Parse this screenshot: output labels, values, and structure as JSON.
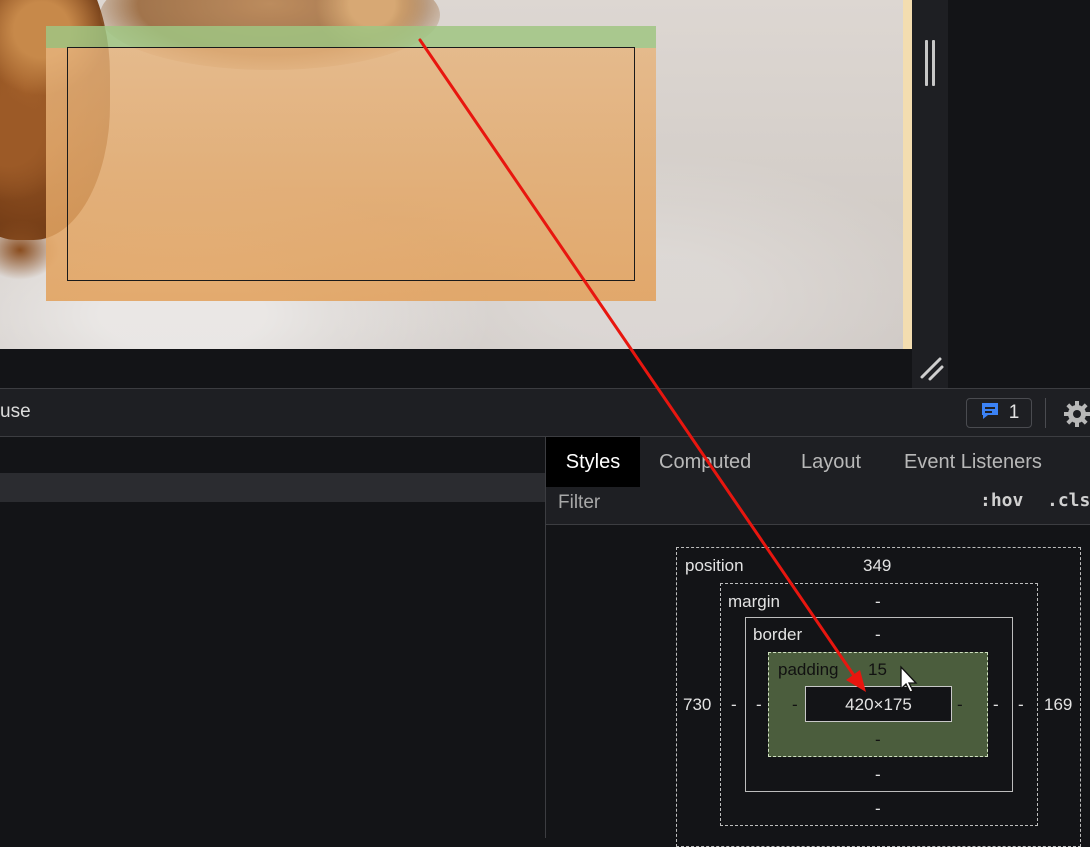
{
  "toolbar": {
    "partial_text": "use",
    "issues_count": "1"
  },
  "styles_tabs": [
    "Styles",
    "Computed",
    "Layout",
    "Event Listeners"
  ],
  "filter": {
    "placeholder": "Filter",
    "hov": ":hov",
    "cls": ".cls"
  },
  "box_model": {
    "position": {
      "label": "position",
      "top": "349",
      "left": "730",
      "right": "169",
      "bottom": "-"
    },
    "margin": {
      "label": "margin",
      "top": "-",
      "left": "-",
      "right": "-",
      "bottom": "-"
    },
    "border": {
      "label": "border",
      "top": "-",
      "left": "-",
      "right": "-",
      "bottom": "-"
    },
    "padding": {
      "label": "padding",
      "top": "15",
      "left": "-",
      "right": "-",
      "bottom": "-"
    },
    "content": "420×175"
  },
  "colors": {
    "margin_highlight": "#a0c582",
    "padding_highlight": "#e4ab70",
    "padding_box": "#4b5d3d",
    "annotation_arrow": "#e8160f",
    "issue_icon": "#3b82f6"
  },
  "icons": [
    "chat-bubble-icon",
    "gear-icon",
    "drag-handle-icon",
    "resize-corner-icon",
    "mouse-cursor-icon"
  ]
}
